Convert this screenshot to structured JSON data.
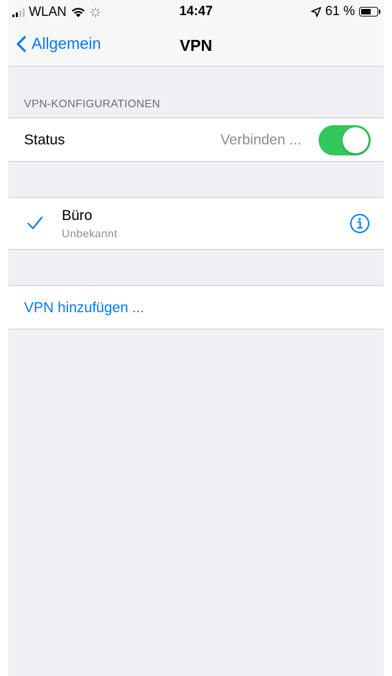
{
  "status_bar": {
    "carrier": "WLAN",
    "time": "14:47",
    "battery_text": "61 %"
  },
  "nav": {
    "back_label": "Allgemein",
    "title": "VPN"
  },
  "section": {
    "header": "VPN-KONFIGURATIONEN"
  },
  "status_row": {
    "label": "Status",
    "value": "Verbinden ...",
    "toggle_on": true
  },
  "vpn_configs": [
    {
      "name": "Büro",
      "subtitle": "Unbekannt",
      "selected": true
    }
  ],
  "add_vpn": {
    "label": "VPN hinzufügen ..."
  },
  "colors": {
    "accent": "#007aff",
    "toggle_on": "#34c759",
    "background": "#efeff4",
    "secondary_text": "#8e8e93"
  }
}
